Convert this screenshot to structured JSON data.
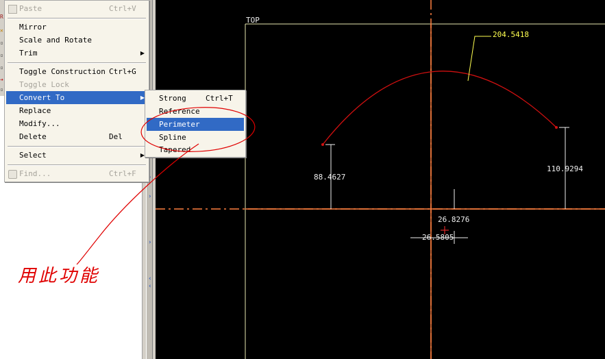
{
  "edit_menu": {
    "items": [
      {
        "label": "Paste",
        "shortcut": "Ctrl+V",
        "disabled": true,
        "icon": "paste-icon"
      },
      {
        "label": "Mirror"
      },
      {
        "label": "Scale and Rotate"
      },
      {
        "label": "Trim",
        "submenu": true
      },
      {
        "label": "Toggle Construction",
        "shortcut": "Ctrl+G"
      },
      {
        "label": "Toggle Lock",
        "disabled": true
      },
      {
        "label": "Convert To",
        "submenu": true,
        "highlighted": true
      },
      {
        "label": "Replace"
      },
      {
        "label": "Modify..."
      },
      {
        "label": "Delete",
        "shortcut": "Del"
      },
      {
        "label": "Select",
        "submenu": true
      },
      {
        "label": "Find...",
        "shortcut": "Ctrl+F",
        "disabled": true,
        "icon": "find-icon"
      }
    ]
  },
  "convert_submenu": {
    "items": [
      {
        "label": "Strong",
        "shortcut": "Ctrl+T"
      },
      {
        "label": "Reference"
      },
      {
        "label": "Perimeter",
        "highlighted": true
      },
      {
        "label": "Spline"
      },
      {
        "label": "Tapered"
      }
    ]
  },
  "sketch": {
    "view_label": "TOP",
    "dimensions": {
      "arc_length": "204.5418",
      "left_height": "88.4627",
      "right_height": "110.9294",
      "small_vertical": "26.8276",
      "small_horizontal": "26.5805"
    }
  },
  "annotation": {
    "text": "用此功能",
    "color": "#e00000"
  },
  "colors": {
    "canvas_bg": "#000000",
    "centerline": "#ff8040",
    "arc": "#d01010",
    "dimension_text": "#f0f0f0",
    "arc_dimension_text": "#ffff50",
    "menu_highlight": "#316ac5"
  }
}
